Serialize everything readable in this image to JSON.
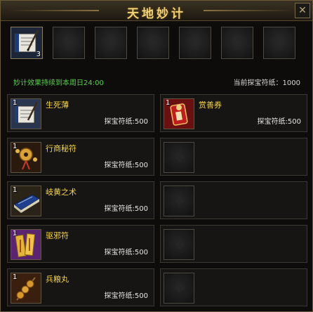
{
  "window": {
    "title": "天地妙计",
    "close_label": "✕"
  },
  "top_slots": {
    "first_count": "3"
  },
  "info": {
    "duration_text": "妙计效果持续到本周日24:00",
    "balance_text": "当前探宝符纸：1000"
  },
  "items": [
    {
      "qty": "1",
      "name": "生死薄",
      "price": "探宝符纸:500",
      "icon": "book-scroll-icon"
    },
    {
      "qty": "1",
      "name": "赏善券",
      "price": "探宝符纸:500",
      "icon": "red-coupon-icon"
    },
    {
      "qty": "1",
      "name": "行商秘符",
      "price": "探宝符纸:500",
      "icon": "golden-charm-icon"
    },
    {
      "qty": "1",
      "name": "岐黄之术",
      "price": "探宝符纸:500",
      "icon": "blue-book-icon"
    },
    {
      "qty": "1",
      "name": "驱邪符",
      "price": "探宝符纸:500",
      "icon": "talisman-icon"
    },
    {
      "qty": "1",
      "name": "兵粮丸",
      "price": "探宝符纸:500",
      "icon": "pill-skewer-icon"
    }
  ],
  "colors": {
    "title": "#f1d27a",
    "item_name": "#f5d44a",
    "duration": "#57d04c"
  }
}
